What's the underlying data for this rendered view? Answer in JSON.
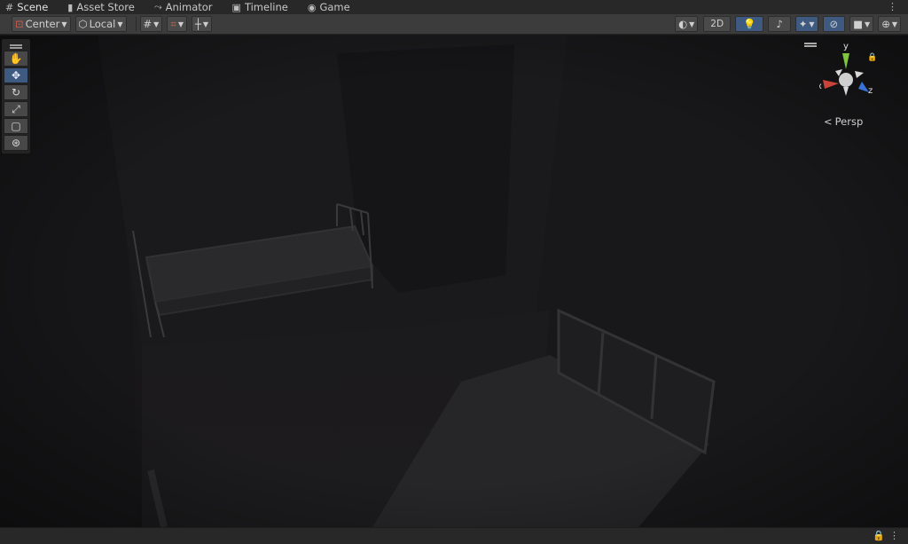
{
  "tabs": [
    {
      "label": "Scene",
      "icon": "#"
    },
    {
      "label": "Asset Store",
      "icon": "🛍"
    },
    {
      "label": "Animator",
      "icon": "⤳"
    },
    {
      "label": "Timeline",
      "icon": "▣"
    },
    {
      "label": "Game",
      "icon": "◉"
    }
  ],
  "toolbar": {
    "pivot_label": "Center",
    "space_label": "Local",
    "twod_label": "2D"
  },
  "gizmo": {
    "x_label": "x",
    "y_label": "y",
    "z_label": "z",
    "projection_label": "Persp",
    "colors": {
      "x": "#c8443b",
      "y": "#7fc63e",
      "z": "#3a73d8"
    }
  },
  "colors": {
    "accent": "#3e5a80",
    "tab_bg": "#282828",
    "toolbar_bg": "#3c3c3c"
  }
}
